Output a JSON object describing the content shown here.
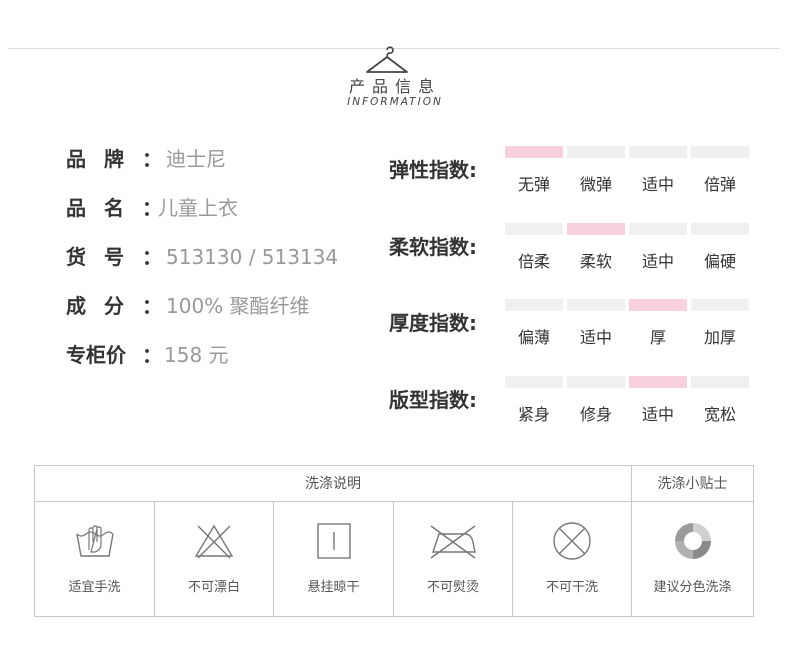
{
  "header": {
    "title_cn": "产品信息",
    "title_en": "INFORMATION"
  },
  "product_info": [
    {
      "label": "品牌",
      "value": "迪士尼"
    },
    {
      "label": "品名",
      "value": "儿童上衣"
    },
    {
      "label": "货号",
      "value": "513130 / 513134"
    },
    {
      "label": "成分",
      "value": "100% 聚酯纤维"
    },
    {
      "label": "专柜价",
      "value": "158 元"
    }
  ],
  "colon": "：",
  "indices": [
    {
      "label": "弹性指数:",
      "options": [
        "无弹",
        "微弹",
        "适中",
        "倍弹"
      ],
      "selected": 0
    },
    {
      "label": "柔软指数:",
      "options": [
        "倍柔",
        "柔软",
        "适中",
        "偏硬"
      ],
      "selected": 1
    },
    {
      "label": "厚度指数:",
      "options": [
        "偏薄",
        "适中",
        "厚",
        "加厚"
      ],
      "selected": 2
    },
    {
      "label": "版型指数:",
      "options": [
        "紧身",
        "修身",
        "适中",
        "宽松"
      ],
      "selected": 2
    }
  ],
  "colors": {
    "bar_selected": "#f9d0de",
    "bar_default": "#f0f0f0",
    "border": "#c8c8c8"
  },
  "care": {
    "washing_title": "洗涤说明",
    "tips_title": "洗涤小贴士",
    "items": [
      {
        "icon": "hand-wash-icon",
        "label": "适宜手洗"
      },
      {
        "icon": "no-bleach-icon",
        "label": "不可漂白"
      },
      {
        "icon": "hang-dry-icon",
        "label": "悬挂晾干"
      },
      {
        "icon": "no-iron-icon",
        "label": "不可熨烫"
      },
      {
        "icon": "no-dry-clean-icon",
        "label": "不可干洗"
      }
    ],
    "tip": {
      "icon": "color-separate-icon",
      "label": "建议分色洗涤"
    }
  }
}
